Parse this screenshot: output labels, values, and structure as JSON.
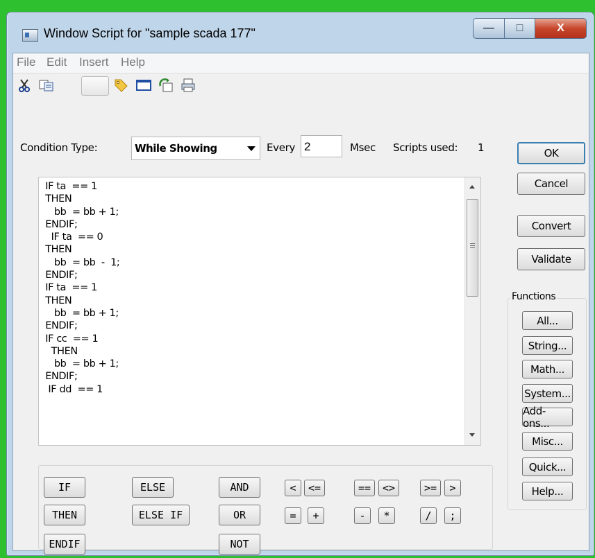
{
  "window": {
    "title": "Window Script for \"sample scada 177\"",
    "caption_buttons": {
      "minimize": "—",
      "maximize": "□",
      "close": "X"
    }
  },
  "menu": [
    "File",
    "Edit",
    "Insert",
    "Help"
  ],
  "toolbar": {
    "icons": [
      "cut-icon",
      "copy-icon",
      "blank-button",
      "tag-icon",
      "window-icon",
      "refresh-icon",
      "print-icon"
    ]
  },
  "condition": {
    "label": "Condition Type:",
    "value": "While Showing",
    "every_label": "Every",
    "every_value": "2",
    "msec_label": "Msec",
    "scripts_used_label": "Scripts used:",
    "scripts_used_value": "1"
  },
  "script_text": " IF ta  == 1\n THEN\n    bb  = bb + 1;\n ENDIF;\n   IF ta  == 0\n THEN\n    bb  = bb  -  1;\n ENDIF;\n IF ta  == 1\n THEN\n    bb  = bb + 1;\n ENDIF;\n IF cc  == 1\n   THEN\n    bb  = bb + 1;\n ENDIF;\n  IF dd  == 1",
  "side_buttons": {
    "ok": "OK",
    "cancel": "Cancel",
    "convert": "Convert",
    "validate": "Validate"
  },
  "functions": {
    "label": "Functions",
    "buttons": [
      "All...",
      "String...",
      "Math...",
      "System...",
      "Add-ons...",
      "Misc...",
      "Quick...",
      "Help..."
    ]
  },
  "keywords": {
    "if": "IF",
    "then": "THEN",
    "endif": "ENDIF",
    "else": "ELSE",
    "else_if": "ELSE IF",
    "and": "AND",
    "or": "OR",
    "not": "NOT"
  },
  "operators": {
    "lt": "<",
    "le": "<=",
    "eq": "==",
    "ne": "<>",
    "ge": ">=",
    "gt": ">",
    "assign": "=",
    "plus": "+",
    "minus": "-",
    "mult": "*",
    "div": "/",
    "semicolon": ";"
  }
}
